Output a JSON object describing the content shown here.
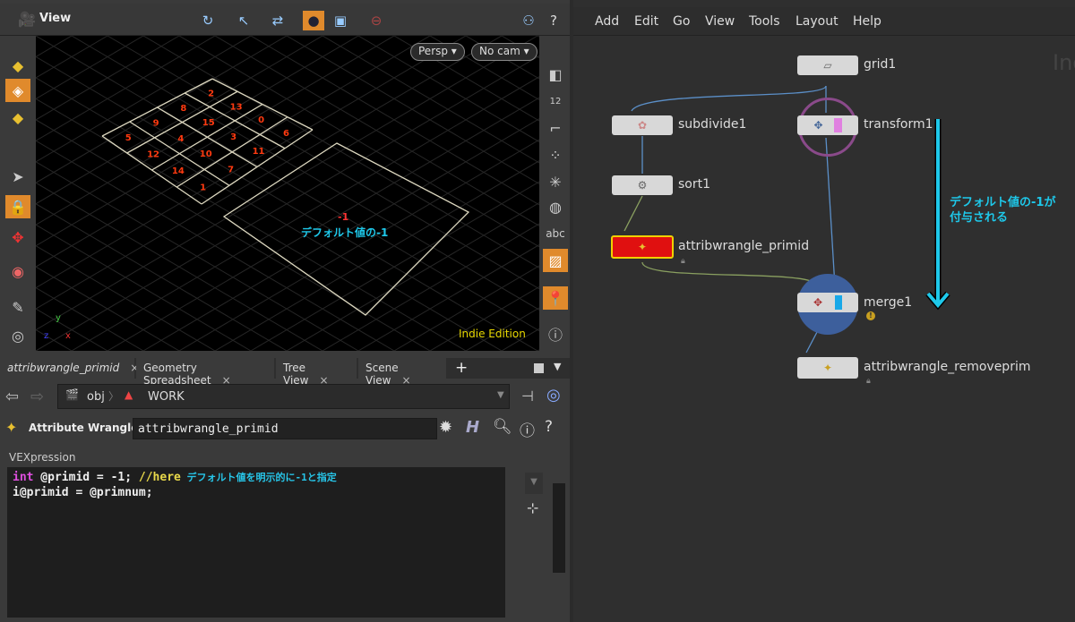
{
  "viewer": {
    "title": "View",
    "persp": "Persp ▾",
    "camera": "No cam ▾",
    "edition": "Indie Edition",
    "side_label": "abc",
    "prim_ids": [
      "5",
      "9",
      "8",
      "2",
      "12",
      "4",
      "15",
      "13",
      "14",
      "10",
      "3",
      "0",
      "1",
      "7",
      "11",
      "6"
    ],
    "default_value_label": "-1",
    "annotation": "デフォルト値の-1",
    "axes": {
      "x": "x",
      "y": "y",
      "z": "z"
    }
  },
  "tabs": [
    {
      "label": "attribwrangle_primid"
    },
    {
      "label": "Geometry Spreadsheet"
    },
    {
      "label": "Tree View"
    },
    {
      "label": "Scene View"
    }
  ],
  "tab_close": "×",
  "tab_add": "+",
  "path": {
    "root": "obj",
    "current": "WORK"
  },
  "params": {
    "node_type": "Attribute Wrangle",
    "node_name": "attribwrangle_primid",
    "section": "VEXpression",
    "code": {
      "l1_kw": "int",
      "l1_code": " @primid = -1; ",
      "l1_comment": "//here",
      "l1_note": " デフォルト値を明示的に-1と指定",
      "l2": "i@primid = @primnum;"
    }
  },
  "network": {
    "menu": [
      "Add",
      "Edit",
      "Go",
      "View",
      "Tools",
      "Layout",
      "Help"
    ],
    "watermark": "Ind",
    "nodes": [
      {
        "name": "grid1"
      },
      {
        "name": "subdivide1"
      },
      {
        "name": "transform1"
      },
      {
        "name": "sort1"
      },
      {
        "name": "attribwrangle_primid"
      },
      {
        "name": "merge1"
      },
      {
        "name": "attribwrangle_removeprim"
      }
    ],
    "annotation_line1": "デフォルト値の-1が",
    "annotation_line2": "付与される",
    "colors": {
      "arrow": "#1ec8ea",
      "selected_node": "#e01010",
      "wire": "#5b8fc8",
      "wire_green": "#8aa060"
    }
  }
}
